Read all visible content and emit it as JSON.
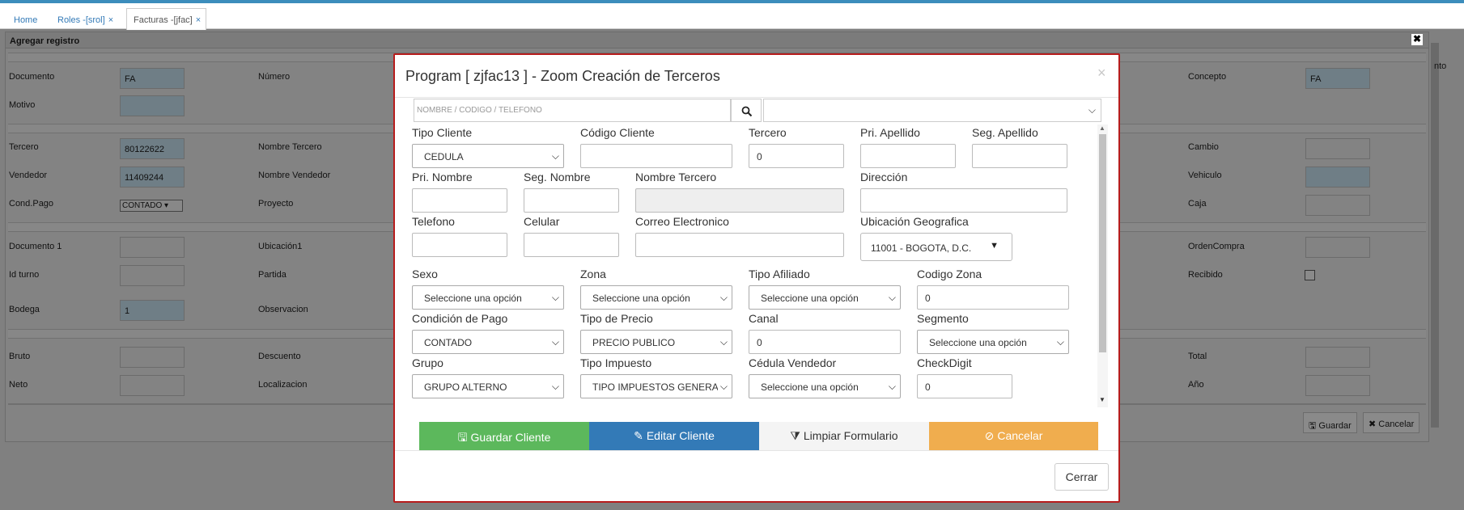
{
  "tabs": [
    {
      "label": "Home",
      "closable": false
    },
    {
      "label": "Roles -[srol]",
      "closable": true
    },
    {
      "label": "Facturas -[jfac]",
      "closable": true,
      "active": true
    }
  ],
  "close_glyph": "×",
  "window": {
    "title": "Agregar registro",
    "close": "✖",
    "labels": {
      "documento": "Documento",
      "numero": "Número",
      "concepto": "Concepto",
      "motivo": "Motivo",
      "tercero": "Tercero",
      "nombre_tercero": "Nombre Tercero",
      "cambio": "Cambio",
      "vendedor": "Vendedor",
      "nombre_vendedor": "Nombre Vendedor",
      "vehiculo": "Vehiculo",
      "cond_pago": "Cond.Pago",
      "proyecto": "Proyecto",
      "caja": "Caja",
      "documento1": "Documento 1",
      "ubicacion1": "Ubicación1",
      "orden_compra": "OrdenCompra",
      "id_turno": "Id turno",
      "partida": "Partida",
      "recibido": "Recibido",
      "bodega": "Bodega",
      "observacion": "Observacion",
      "bruto": "Bruto",
      "descuento": "Descuento",
      "total": "Total",
      "neto": "Neto",
      "localizacion": "Localizacion",
      "anio": "Año"
    },
    "values": {
      "documento": "FA",
      "concepto": "FA",
      "tercero": "80122622",
      "vendedor": "11409244",
      "cond_pago": "CONTADO ▾",
      "bodega": "1"
    },
    "guardar": "🖫 Guardar",
    "cancelar": "✖ Cancelar",
    "partial_right": "nto"
  },
  "modal": {
    "title": "Program [ zjfac13 ] - Zoom Creación de Terceros",
    "close": "×",
    "search_placeholder": "NOMBRE / CODIGO / TELEFONO",
    "search_icon": "magnifier-icon",
    "chev": "⌵",
    "caret": "▼",
    "labels": {
      "tipo_cliente": "Tipo Cliente",
      "codigo_cliente": "Código Cliente",
      "tercero": "Tercero",
      "pri_apellido": "Pri. Apellido",
      "seg_apellido": "Seg. Apellido",
      "pri_nombre": "Pri. Nombre",
      "seg_nombre": "Seg. Nombre",
      "nombre_tercero": "Nombre Tercero",
      "direccion": "Dirección",
      "telefono": "Telefono",
      "celular": "Celular",
      "correo": "Correo Electronico",
      "ubicacion": "Ubicación Geografica",
      "sexo": "Sexo",
      "zona": "Zona",
      "tipo_afiliado": "Tipo Afiliado",
      "codigo_zona": "Codigo Zona",
      "condicion_pago": "Condición de Pago",
      "tipo_precio": "Tipo de Precio",
      "canal": "Canal",
      "segmento": "Segmento",
      "grupo": "Grupo",
      "tipo_impuesto": "Tipo Impuesto",
      "cedula_vendedor": "Cédula Vendedor",
      "checkdigit": "CheckDigit"
    },
    "values": {
      "tipo_cliente": "CEDULA",
      "tercero": "0",
      "ubicacion": "11001 - BOGOTA, D.C.",
      "sexo": "Seleccione una opción",
      "zona": "Seleccione una opción",
      "tipo_afiliado": "Seleccione una opción",
      "codigo_zona": "0",
      "condicion_pago": "CONTADO",
      "tipo_precio": "PRECIO PUBLICO",
      "canal": "0",
      "segmento": "Seleccione una opción",
      "grupo": "GRUPO ALTERNO",
      "tipo_impuesto": "TIPO IMPUESTOS GENERAL",
      "cedula_vendedor": "Seleccione una opción",
      "checkdigit": "0"
    },
    "buttons": {
      "guardar": {
        "label": "Guardar Cliente",
        "icon": "🖫",
        "color": "#5cb85c"
      },
      "editar": {
        "label": "Editar Cliente",
        "icon": "✎",
        "color": "#337ab7"
      },
      "limpiar": {
        "label": "Limpiar Formulario",
        "icon": "⧩",
        "color": "#f4f4f4"
      },
      "cancelar": {
        "label": "Cancelar",
        "icon": "⊘",
        "color": "#f0ad4e"
      }
    },
    "cerrar": "Cerrar"
  }
}
